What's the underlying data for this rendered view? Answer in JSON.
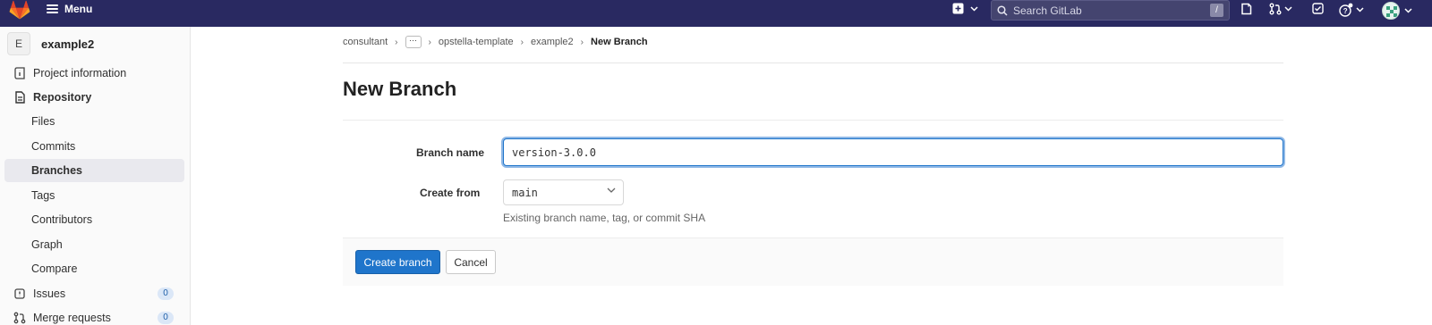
{
  "topbar": {
    "menu_label": "Menu",
    "search_placeholder": "Search GitLab",
    "search_shortcut": "/"
  },
  "sidebar": {
    "project_initial": "E",
    "project_name": "example2",
    "items": [
      {
        "label": "Project information",
        "icon": "info-icon"
      },
      {
        "label": "Repository",
        "icon": "document-icon"
      },
      {
        "label": "Files"
      },
      {
        "label": "Commits"
      },
      {
        "label": "Branches"
      },
      {
        "label": "Tags"
      },
      {
        "label": "Contributors"
      },
      {
        "label": "Graph"
      },
      {
        "label": "Compare"
      },
      {
        "label": "Issues",
        "icon": "issues-icon",
        "count": "0"
      },
      {
        "label": "Merge requests",
        "icon": "merge-request-icon",
        "count": "0"
      }
    ]
  },
  "breadcrumb": {
    "items": [
      "consultant",
      "opstella-template",
      "example2",
      "New Branch"
    ],
    "ellipsis": "···"
  },
  "page_title": "New Branch",
  "form": {
    "branch_name_label": "Branch name",
    "branch_name_value": "version-3.0.0",
    "create_from_label": "Create from",
    "create_from_value": "main",
    "help_text": "Existing branch name, tag, or commit SHA"
  },
  "actions": {
    "create_label": "Create branch",
    "cancel_label": "Cancel"
  },
  "colors": {
    "navbar": "#292961",
    "primary": "#1f75cb",
    "logo": "#fc6d26"
  }
}
